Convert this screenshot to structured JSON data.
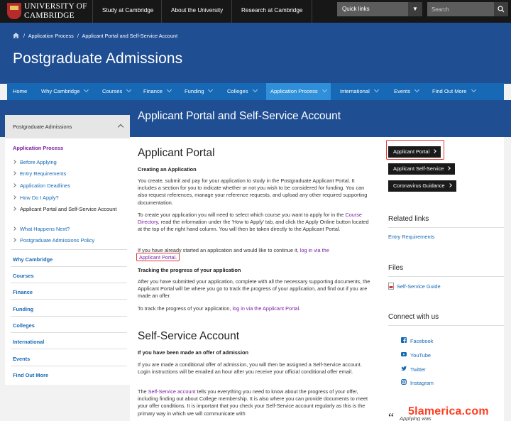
{
  "brand": {
    "line1": "UNIVERSITY OF",
    "line2": "CAMBRIDGE",
    "crest_color": "#b52a2a"
  },
  "topnav": [
    "Study at Cambridge",
    "About the University",
    "Research at Cambridge"
  ],
  "quick_links": {
    "label": "Quick links"
  },
  "search": {
    "placeholder": "Search"
  },
  "breadcrumb": [
    "Application Process",
    "Applicant Portal and Self-Service Account"
  ],
  "site_title": "Postgraduate Admissions",
  "mainnav": [
    "Home",
    "Why Cambridge",
    "Courses",
    "Finance",
    "Funding",
    "Colleges",
    "Application Process",
    "International",
    "Events",
    "Find Out More"
  ],
  "mainnav_active": "Application Process",
  "page_heading": "Applicant Portal and Self-Service Account",
  "sidebar": {
    "header": "Postgraduate Admissions",
    "section": "Application Process",
    "items": [
      "Before Applying",
      "Entry Requirements",
      "Application Deadlines",
      "How Do I Apply?",
      "Applicant Portal and Self-Service Account",
      "What Happens Next?",
      "Postgraduate Admissions Policy"
    ],
    "sections": [
      "Why Cambridge",
      "Courses",
      "Finance",
      "Funding",
      "Colleges",
      "International",
      "Events",
      "Find Out More"
    ]
  },
  "portal": {
    "title": "Applicant Portal",
    "creating_heading": "Creating an Application",
    "p1": "You create, submit and pay for your application to study in the Postgraduate Applicant Portal. It includes a section for you to indicate whether or not you wish to be considered for funding. You can also request references, manage your reference requests, and upload any other required supporting documentation.",
    "p2_pre": "To create your application you will need to select which course you want to apply for in the ",
    "p2_link": "Course Directory",
    "p2_post": ", read the information under the 'How to Apply' tab, and click the Apply Online button located at the top of the right hand column. You will then be taken directly to the Applicant Portal.",
    "p3_pre": "If you have already started an application and would like to continue it, ",
    "p3_link_a": "log in via the",
    "p3_link_b": "Applicant Portal",
    "p3_post": ".",
    "tracking_heading": "Tracking the progress of your application",
    "p4": "After you have submitted your application, complete with all the necessary supporting documents, the Applicant Portal will be where you go to track the progress of your application, and find out if you are made an offer.",
    "p5_pre": "To track the progress of your application, ",
    "p5_link": "log in via the Applicant Portal",
    "p5_post": "."
  },
  "selfservice": {
    "title": "Self-Service Account",
    "offer_heading": "If you have been made an offer of admission",
    "p1": "If you are made a conditional offer of admission, you will then be assigned a Self-Service account. Login instructions will be emailed an hour after you receive your official conditional offer email.",
    "p2_pre": "The ",
    "p2_link": "Self-Service account",
    "p2_post": " tells you everything you need to know about the progress of your offer, including finding out about College membership. It is also where you can provide documents to meet your offer conditions. It is important that you check your Self-Service account regularly as this is the primary way in which we will communicate with"
  },
  "right": {
    "buttons": [
      "Applicant Portal",
      "Applicant Self-Service",
      "Coronavirus Guidance"
    ],
    "related_heading": "Related links",
    "related": [
      "Entry Requirements"
    ],
    "files_heading": "Files",
    "files": [
      "Self-Service Guide"
    ],
    "connect_heading": "Connect with us",
    "social": [
      "Facebook",
      "YouTube",
      "Twitter",
      "Instagram"
    ],
    "quote_mark": "“",
    "quote_text": "Applying was"
  },
  "watermark": "5lamerica.com"
}
